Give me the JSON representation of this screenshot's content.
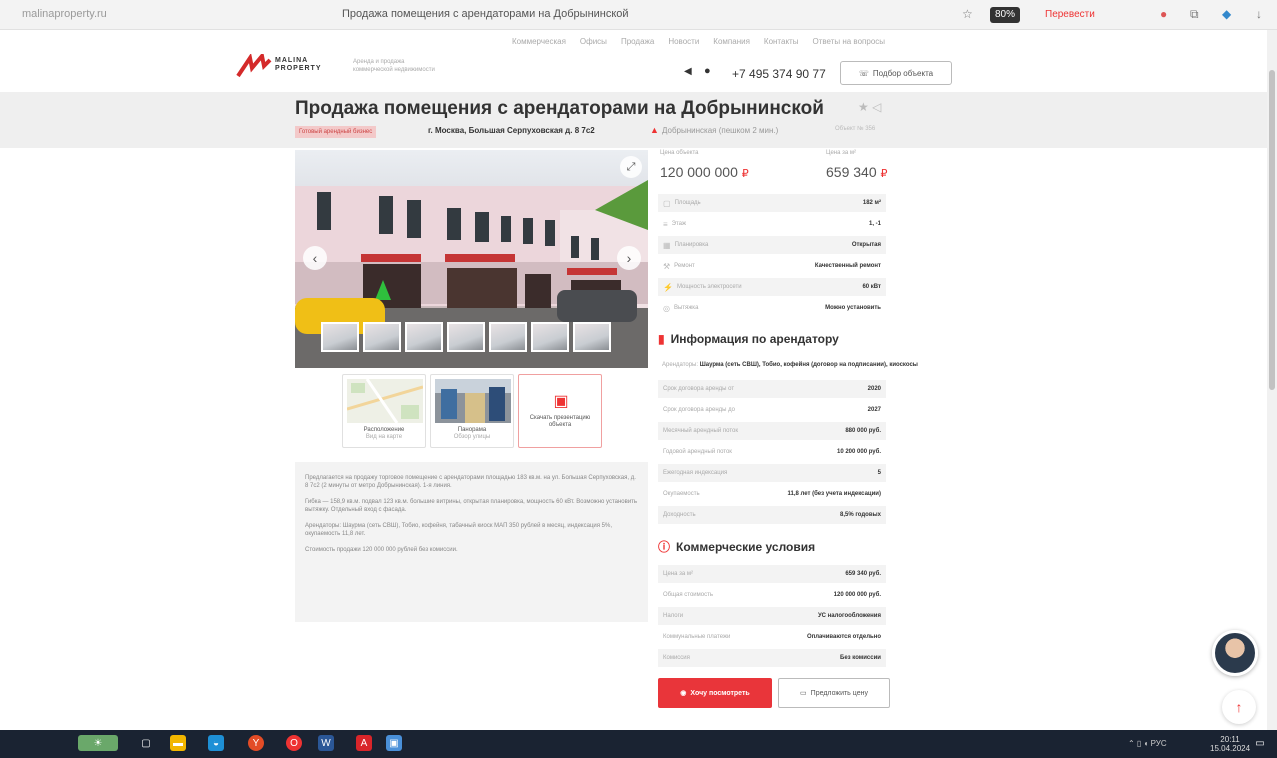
{
  "browser": {
    "url": "malinaproperty.ru",
    "page_title": "Продажа помещения с арендаторами на Добрынинской",
    "zoom": "80%",
    "translate_label": "Перевести"
  },
  "site": {
    "nav": [
      "Коммерческая",
      "Офисы",
      "Продажа",
      "Новости",
      "Компания",
      "Контакты",
      "Ответы на вопросы"
    ],
    "logo": "MALINA\nPROPERTY",
    "tagline": "Аренда и продажа\nкоммерческой недвижимости",
    "phone": "+7 495 374 90 77",
    "callback_label": "Подбор объекта"
  },
  "listing": {
    "title": "Продажа помещения с арендаторами на Добрынинской",
    "tag": "Готовый арендный бизнес",
    "address": "г. Москва, Большая Серпуховская д. 8 7с2",
    "metro": "Добрынинская (пешком 2 мин.)",
    "lot": "Объект № 356"
  },
  "tiles": [
    {
      "title": "Расположение",
      "sub": "Вид на карте"
    },
    {
      "title": "Панорама",
      "sub": "Обзор улицы"
    },
    {
      "title": "Скачать презентацию объекта",
      "sub": ""
    }
  ],
  "description": [
    "Предлагается на продажу торговое помещение с арендаторами площадью 183 кв.м. на ул. Большая Серпуховская, д. 8 7с2 (2 минуты от метро Добрынинская). 1-я линия.",
    "Гибка — 158,9 кв.м. подвал 123 кв.м. большие витрины, открытая планировка, мощность 60 кВт. Возможно установить вытяжку. Отдельный вход с фасада.",
    "Арендаторы: Шаурма (сеть СВШ), Тобио, кофейня, табачный киоск МАП 350 рублей в месяц, индексация 5%, окупаемость 11,8 лет.",
    "Стоимость продажи 120 000 000 рублей без комиссии."
  ],
  "prices": {
    "total_label": "Цена объекта",
    "total": "120 000 000",
    "sqm_label": "Цена за м²",
    "sqm": "659 340"
  },
  "params": [
    {
      "icon": "area-icon",
      "glyph": "▢",
      "k": "Площадь",
      "v": "182 м²"
    },
    {
      "icon": "floor-icon",
      "glyph": "≡",
      "k": "Этаж",
      "v": "1, -1"
    },
    {
      "icon": "layout-icon",
      "glyph": "▦",
      "k": "Планировка",
      "v": "Открытая"
    },
    {
      "icon": "repair-icon",
      "glyph": "⚒",
      "k": "Ремонт",
      "v": "Качественный ремонт"
    },
    {
      "icon": "power-icon",
      "glyph": "⚡",
      "k": "Мощность электросети",
      "v": "60 кВт"
    },
    {
      "icon": "hood-icon",
      "glyph": "◎",
      "k": "Вытяжка",
      "v": "Можно установить"
    }
  ],
  "tenant_section": {
    "title": "Информация по арендатору",
    "tenants_label": "Арендаторы:",
    "tenants_value": "Шаурма (сеть СВШ), Тобио, кофейня (договор на подписании), киоскосы",
    "rows": [
      {
        "k": "Срок договора аренды от",
        "v": "2020"
      },
      {
        "k": "Срок договора аренды до",
        "v": "2027"
      },
      {
        "k": "Месячный арендный поток",
        "v": "880 000 руб."
      },
      {
        "k": "Годовой арендный поток",
        "v": "10 200 000 руб."
      },
      {
        "k": "Ежегодная индексация",
        "v": "5"
      },
      {
        "k": "Окупаемость",
        "v": "11,8 лет (без учета индексации)"
      },
      {
        "k": "Доходность",
        "v": "8,5% годовых"
      }
    ]
  },
  "commercial": {
    "title": "Коммерческие условия",
    "rows": [
      {
        "k": "Цена за м²",
        "v": "659 340 руб."
      },
      {
        "k": "Общая стоимость",
        "v": "120 000 000 руб."
      },
      {
        "k": "Налоги",
        "v": "УС налогообложения"
      },
      {
        "k": "Коммунальные платежи",
        "v": "Оплачиваются отдельно"
      },
      {
        "k": "Комиссия",
        "v": "Без комиссии"
      }
    ]
  },
  "actions": {
    "view": "Хочу посмотреть",
    "offer": "Предложить цену"
  },
  "taskbar": {
    "time": "20:11",
    "date": "15.04.2024",
    "lang": "РУС"
  }
}
